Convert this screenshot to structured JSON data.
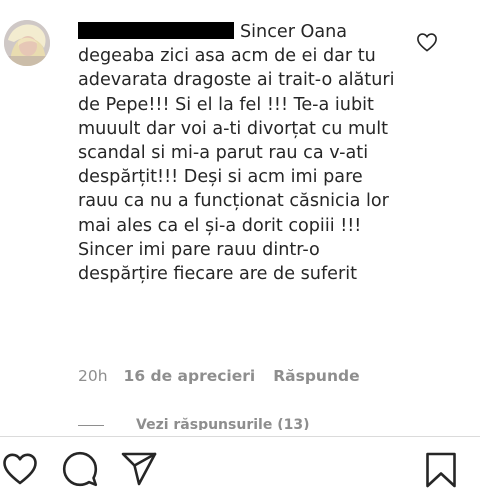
{
  "comment": {
    "username": "",
    "text": "Sincer Oana degeaba zici asa acm de ei dar tu adevarata dragoste ai trait-o alături de Pepe!!! Si el la fel !!! Te-a iubit muuult dar voi a-ti divorțat cu mult scandal si mi-a parut rau ca v-ati despărțit!!! Deși si acm imi pare rauu ca nu a funcționat căsnicia lor mai ales ca el și-a dorit copiii !!! Sincer imi pare rauu dintr-o despărțire fiecare are de suferit",
    "time": "20h",
    "likes": "16 de aprecieri",
    "reply_label": "Răspunde",
    "like_icon": "heart-outline-icon"
  },
  "view_replies": "Vezi răspunsurile (13)",
  "action_bar": {
    "icons": [
      "heart-outline-icon",
      "comment-icon",
      "share-icon",
      "bookmark-icon"
    ]
  }
}
